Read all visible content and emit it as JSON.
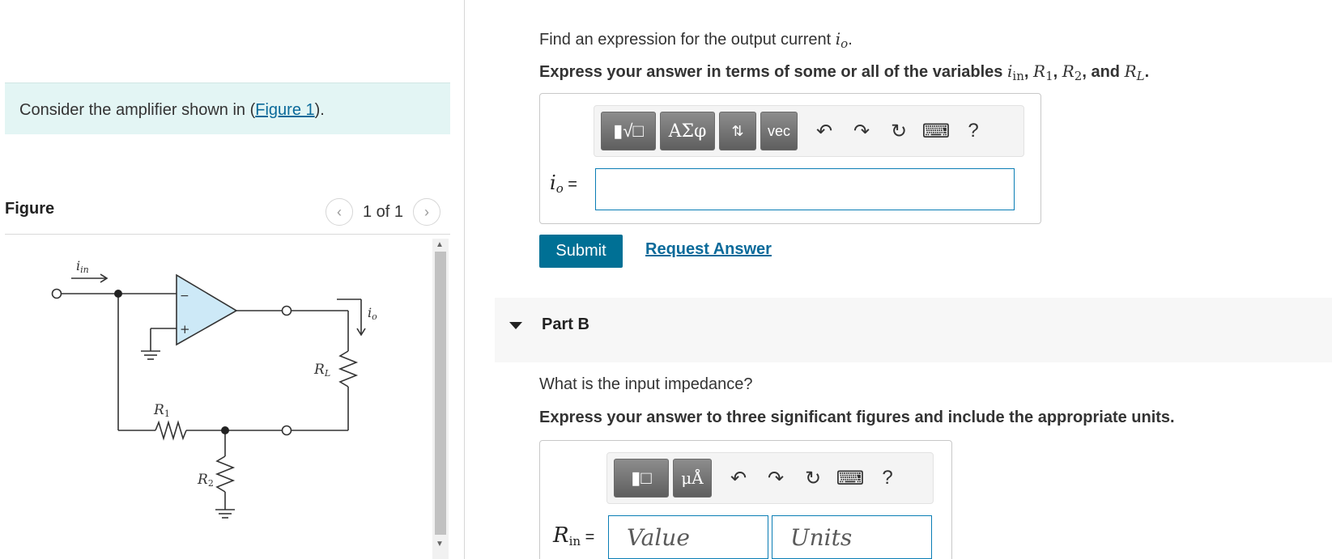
{
  "intro": {
    "prefix": "Consider the amplifier shown in (",
    "link": "Figure 1",
    "suffix": ")."
  },
  "figure": {
    "title": "Figure",
    "pager_text": "1 of 1",
    "prev_icon": "chevron-left-icon",
    "next_icon": "chevron-right-icon",
    "labels": {
      "iin": "in",
      "io": "o",
      "R1": "R",
      "R1sub": "1",
      "R2": "R",
      "R2sub": "2",
      "RL": "R",
      "RLsub": "L",
      "minus": "−",
      "plus": "+"
    }
  },
  "part_a": {
    "question": "Find an expression for the output current ",
    "question_var": "i",
    "question_var_sub": "o",
    "question_end": ".",
    "instruction_prefix": "Express your answer in terms of some or all of the variables ",
    "instruction_vars": {
      "iin": "i",
      "iin_sub": "in",
      "R1": "R",
      "R1_sub": "1",
      "R2": "R",
      "R2_sub": "2",
      "RL": "R",
      "RL_sub": "L"
    },
    "sep1": ", ",
    "sep2": ", ",
    "and": ", and ",
    "instruction_end": ".",
    "toolbar": {
      "templates_label": "▮√□",
      "greek_label": "ΑΣφ",
      "arrows_label": "⇅",
      "vec_label": "vec",
      "icons": [
        "undo-icon",
        "redo-icon",
        "reset-icon",
        "keyboard-icon",
        "help-icon"
      ],
      "undo": "↶",
      "redo": "↷",
      "reset": "↻",
      "keyboard": "⌨",
      "help": "?"
    },
    "answer_var": "i",
    "answer_var_sub": "o",
    "answer_eq": " =",
    "answer_value": "",
    "submit_label": "Submit",
    "request_label": "Request Answer"
  },
  "part_b": {
    "title": "Part B",
    "question": "What is the input impedance?",
    "instruction": "Express your answer to three significant figures and include the appropriate units.",
    "toolbar": {
      "templates_label": "▮□",
      "units_label": "μÅ",
      "undo": "↶",
      "redo": "↷",
      "reset": "↻",
      "keyboard": "⌨",
      "help": "?"
    },
    "answer_var": "R",
    "answer_var_sub": "in",
    "answer_eq": " =",
    "value_placeholder": "Value",
    "units_placeholder": "Units"
  },
  "colors": {
    "intro_bg": "#e3f5f4",
    "link": "#0a6a9a",
    "submit_bg": "#007095",
    "opamp_fill": "#cde9f7",
    "input_border": "#0a7db5"
  }
}
